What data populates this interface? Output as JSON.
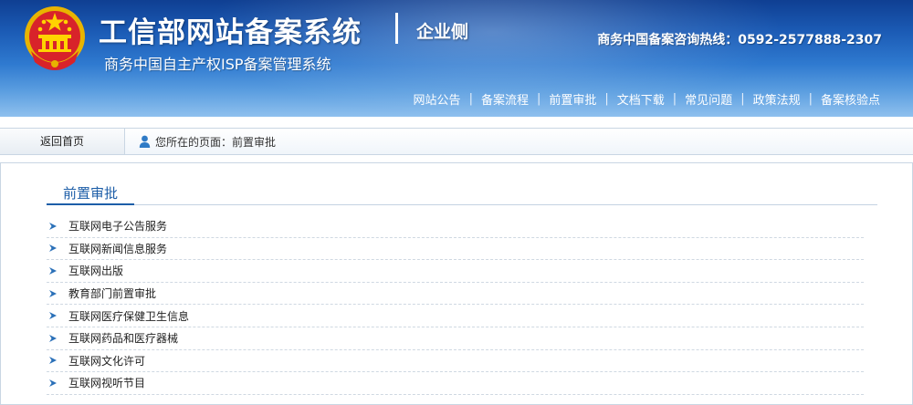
{
  "header": {
    "title": "工信部网站备案系统",
    "side_label": "企业侧",
    "subtitle": "商务中国自主产权ISP备案管理系统",
    "hotline": "商务中国备案咨询热线：0592-2577888-2307",
    "nav": [
      {
        "label": "网站公告"
      },
      {
        "label": "备案流程"
      },
      {
        "label": "前置审批"
      },
      {
        "label": "文档下载"
      },
      {
        "label": "常见问题"
      },
      {
        "label": "政策法规"
      },
      {
        "label": "备案核验点"
      }
    ],
    "nav_separator": "|"
  },
  "breadcrumb": {
    "home_label": "返回首页",
    "location_text": "您所在的页面：前置审批"
  },
  "main": {
    "section_title": "前置审批",
    "items": [
      {
        "label": "互联网电子公告服务"
      },
      {
        "label": "互联网新闻信息服务"
      },
      {
        "label": "互联网出版"
      },
      {
        "label": "教育部门前置审批"
      },
      {
        "label": "互联网医疗保健卫生信息"
      },
      {
        "label": "互联网药品和医疗器械"
      },
      {
        "label": "互联网文化许可"
      },
      {
        "label": "互联网视听节目"
      }
    ]
  },
  "icons": {
    "emblem": "national-emblem-icon",
    "user": "user-icon",
    "list_arrow": "arrow-right-icon"
  },
  "colors": {
    "header_dark": "#0f3f92",
    "header_light": "#8fc0ee",
    "accent": "#1d5ea8",
    "arrow": "#2a70b8"
  }
}
